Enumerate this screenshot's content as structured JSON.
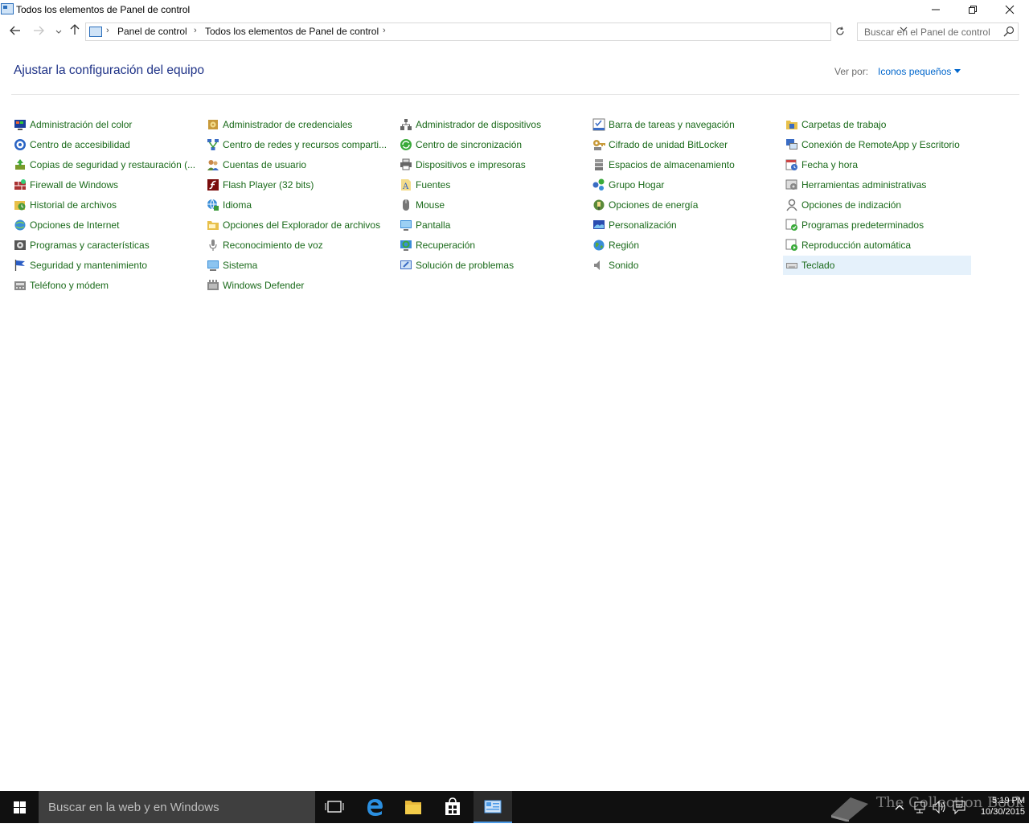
{
  "window": {
    "title": "Todos los elementos de Panel de control"
  },
  "nav": {
    "breadcrumbs": [
      "Panel de control",
      "Todos los elementos de Panel de control"
    ],
    "search_placeholder": "Buscar en el Panel de control"
  },
  "header": {
    "title": "Ajustar la configuración del equipo",
    "view_by_label": "Ver por:",
    "view_by_value": "Iconos pequeños"
  },
  "items": {
    "col1": [
      {
        "label": "Administración del color",
        "icon": "color-management-icon"
      },
      {
        "label": "Centro de accesibilidad",
        "icon": "accessibility-icon"
      },
      {
        "label": "Copias de seguridad y restauración (...",
        "icon": "backup-icon"
      },
      {
        "label": "Firewall de Windows",
        "icon": "firewall-icon"
      },
      {
        "label": "Historial de archivos",
        "icon": "file-history-icon"
      },
      {
        "label": "Opciones de Internet",
        "icon": "internet-options-icon"
      },
      {
        "label": "Programas y características",
        "icon": "programs-icon"
      },
      {
        "label": "Seguridad y mantenimiento",
        "icon": "flag-icon"
      },
      {
        "label": "Teléfono y módem",
        "icon": "phone-modem-icon"
      }
    ],
    "col2": [
      {
        "label": "Administrador de credenciales",
        "icon": "credentials-icon"
      },
      {
        "label": "Centro de redes y recursos comparti...",
        "icon": "network-icon"
      },
      {
        "label": "Cuentas de usuario",
        "icon": "user-accounts-icon"
      },
      {
        "label": "Flash Player (32 bits)",
        "icon": "flash-icon"
      },
      {
        "label": "Idioma",
        "icon": "language-icon"
      },
      {
        "label": "Opciones del Explorador de archivos",
        "icon": "folder-options-icon"
      },
      {
        "label": "Reconocimiento de voz",
        "icon": "microphone-icon"
      },
      {
        "label": "Sistema",
        "icon": "system-icon"
      },
      {
        "label": "Windows Defender",
        "icon": "defender-icon"
      }
    ],
    "col3": [
      {
        "label": "Administrador de dispositivos",
        "icon": "device-manager-icon"
      },
      {
        "label": "Centro de sincronización",
        "icon": "sync-icon"
      },
      {
        "label": "Dispositivos e impresoras",
        "icon": "printer-icon"
      },
      {
        "label": "Fuentes",
        "icon": "fonts-icon"
      },
      {
        "label": "Mouse",
        "icon": "mouse-icon"
      },
      {
        "label": "Pantalla",
        "icon": "display-icon"
      },
      {
        "label": "Recuperación",
        "icon": "recovery-icon"
      },
      {
        "label": "Solución de problemas",
        "icon": "troubleshoot-icon"
      }
    ],
    "col4": [
      {
        "label": "Barra de tareas y navegación",
        "icon": "taskbar-icon"
      },
      {
        "label": "Cifrado de unidad BitLocker",
        "icon": "bitlocker-icon"
      },
      {
        "label": "Espacios de almacenamiento",
        "icon": "storage-icon"
      },
      {
        "label": "Grupo Hogar",
        "icon": "homegroup-icon"
      },
      {
        "label": "Opciones de energía",
        "icon": "power-icon"
      },
      {
        "label": "Personalización",
        "icon": "personalization-icon"
      },
      {
        "label": "Región",
        "icon": "region-icon"
      },
      {
        "label": "Sonido",
        "icon": "speaker-icon"
      }
    ],
    "col5": [
      {
        "label": "Carpetas de trabajo",
        "icon": "work-folders-icon"
      },
      {
        "label": "Conexión de RemoteApp y Escritorio",
        "icon": "remoteapp-icon"
      },
      {
        "label": "Fecha y hora",
        "icon": "date-time-icon"
      },
      {
        "label": "Herramientas administrativas",
        "icon": "admin-tools-icon"
      },
      {
        "label": "Opciones de indización",
        "icon": "indexing-icon"
      },
      {
        "label": "Programas predeterminados",
        "icon": "default-programs-icon"
      },
      {
        "label": "Reproducción automática",
        "icon": "autoplay-icon"
      },
      {
        "label": "Teclado",
        "icon": "keyboard-icon"
      }
    ]
  },
  "selected_item": "Teclado",
  "taskbar": {
    "search_placeholder": "Buscar en la web y en Windows",
    "time": "5:19 PM",
    "date": "10/30/2015",
    "watermark": "The Collection Book"
  },
  "colors": {
    "link_green": "#1a6a1a",
    "title_blue": "#1e3287",
    "accent_blue": "#0066cc",
    "taskbar": "#101010",
    "selection": "#e5f1fb"
  }
}
